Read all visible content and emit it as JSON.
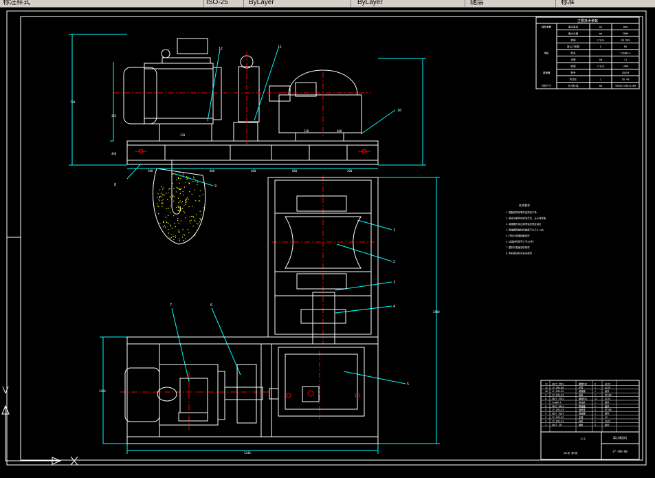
{
  "app": {
    "toolbar_items": [
      "标注样式",
      "ISO-25",
      "ByLayer",
      "ByLayer",
      "随层",
      "标准"
    ],
    "drawing_number": "JY-ZHS-00",
    "part_name": "离心铸造机",
    "scale": "1:5",
    "sheet_label": "共1张 第1张"
  },
  "parameters_table": {
    "title": "主要技术参数",
    "rows": [
      [
        "铸件参数",
        "最大直径",
        "mm",
        "800"
      ],
      [
        "",
        "最大长度",
        "mm",
        "3000"
      ],
      [
        "",
        "转速",
        "r/min",
        "40-500"
      ],
      [
        "",
        "离心力系数",
        "G",
        "80"
      ],
      [
        "电机",
        "型号",
        "",
        "Y160M-4"
      ],
      [
        "",
        "功率",
        "kW",
        "11"
      ],
      [
        "",
        "转速",
        "r/min",
        "1460"
      ],
      [
        "减速器",
        "型号",
        "",
        "ZQ350"
      ],
      [
        "",
        "传动比",
        "i",
        "20.49"
      ],
      [
        "外形尺寸",
        "长×宽×高",
        "mm",
        "3340×1450×1260"
      ]
    ]
  },
  "notes": {
    "title": "技术要求",
    "lines": [
      "1.装配前所有零件应清洗干净",
      "2.各运动部件应转动灵活，无卡滞现象",
      "3.减速器内加注润滑油至规定油位",
      "4.联轴器两轴线同轴度不大于0.1mm",
      "5.托轮与滚道接触良好",
      "6.试运转时间不少于2小时",
      "7.整机外表面涂防锈漆",
      "8.电机接线符合安全规范"
    ]
  },
  "balloons": [
    "1",
    "2",
    "3",
    "4",
    "5",
    "6",
    "7",
    "8",
    "9",
    "10",
    "11",
    "12"
  ],
  "dimensions": {
    "top_view_lengths": [
      "300",
      "800",
      "400",
      "800",
      "200"
    ],
    "top_heights": [
      "365",
      "440",
      "780"
    ],
    "bottom_width": "3340",
    "right_height": "2400",
    "left_height": "1450",
    "motor_dims": [
      "220",
      "120",
      "400"
    ]
  },
  "bom": {
    "header": [
      "序号",
      "代号",
      "名称",
      "数量",
      "材料"
    ],
    "rows": [
      [
        "12",
        "GB/T 5782",
        "螺栓M16",
        "8",
        "Q235"
      ],
      [
        "11",
        "JY-ZHS-06",
        "护罩",
        "1",
        "Q235"
      ],
      [
        "10",
        "JY-ZHS-05",
        "减速器",
        "1",
        "组件"
      ],
      [
        "9",
        "JY-ZHS-04",
        "底座",
        "1",
        "HT200"
      ],
      [
        "8",
        "GB/T 5783",
        "螺栓M12",
        "12",
        "Q235"
      ],
      [
        "7",
        "Y160M-4",
        "电动机",
        "1",
        "组件"
      ],
      [
        "6",
        "GB/T 5014",
        "联轴器",
        "1",
        "组件"
      ],
      [
        "5",
        "JY-ZHS-03",
        "轴承座",
        "4",
        "HT200"
      ],
      [
        "4",
        "GB/T 5014",
        "联轴器",
        "1",
        "组件"
      ],
      [
        "3",
        "JY-ZHS-02",
        "主轴",
        "1",
        "45"
      ],
      [
        "2",
        "JY-ZHS-01",
        "托轮",
        "2",
        "ZG35"
      ],
      [
        "1",
        "GB/T 297",
        "轴承",
        "4",
        "组件"
      ]
    ]
  },
  "colors": {
    "background": "#000000",
    "white": "#ffffff",
    "cyan": "#00ffff",
    "red": "#ff0000",
    "yellow": "#ffff00",
    "border_gray": "#c0c0c0"
  }
}
